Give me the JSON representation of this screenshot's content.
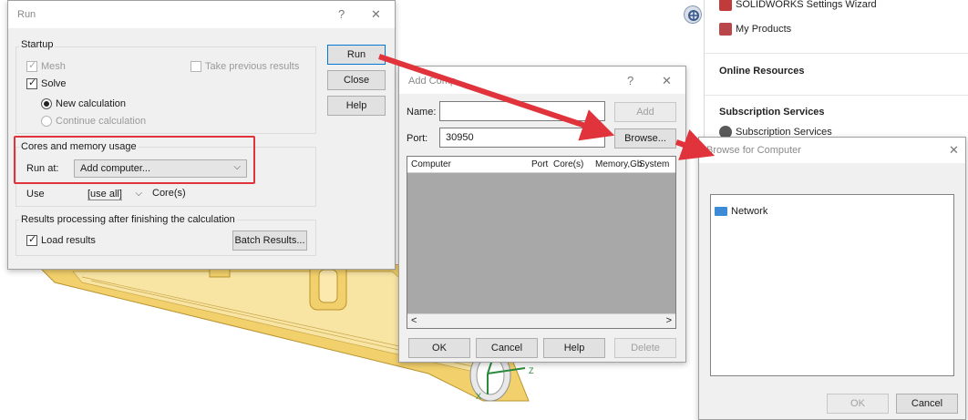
{
  "taskpane": {
    "wizard_label": "SOLIDWORKS Settings Wizard",
    "my_products": "My Products",
    "online_resources": "Online Resources",
    "subscription_services_head": "Subscription Services",
    "subscription_services_item": "Subscription Services"
  },
  "run_dialog": {
    "title": "Run",
    "help_glyph": "?",
    "close_glyph": "✕",
    "startup_group": "Startup",
    "mesh_label": "Mesh",
    "solve_label": "Solve",
    "take_previous_label": "Take previous results",
    "new_calc_label": "New calculation",
    "continue_calc_label": "Continue calculation",
    "cores_group": "Cores and memory usage",
    "run_at_label": "Run at:",
    "run_at_value": "Add computer...",
    "use_label": "Use",
    "use_value": "[use all]",
    "cores_suffix": "Core(s)",
    "results_group": "Results processing after finishing the calculation",
    "load_results_label": "Load results",
    "run_button": "Run",
    "close_button": "Close",
    "help_button": "Help",
    "batch_results_button": "Batch Results..."
  },
  "add_dialog": {
    "title": "Add Comp",
    "help_glyph": "?",
    "close_glyph": "✕",
    "name_label": "Name:",
    "name_value": "",
    "port_label": "Port:",
    "port_value": "30950",
    "add_button": "Add",
    "browse_button": "Browse...",
    "columns": [
      "Computer",
      "Port",
      "Core(s)",
      "Memory,Gb",
      "System"
    ],
    "scroll_left": "<",
    "scroll_right": ">",
    "ok_button": "OK",
    "cancel_button": "Cancel",
    "help_button": "Help",
    "delete_button": "Delete"
  },
  "browse_dialog": {
    "title": "Browse for Computer",
    "close_glyph": "✕",
    "tree_items": [
      "Network"
    ],
    "ok_button": "OK",
    "cancel_button": "Cancel"
  },
  "model": {
    "axis_z": "Z",
    "axis_x": "X"
  },
  "colors": {
    "arrow": "#e0333b",
    "part_fill": "#f2d06b",
    "part_edge": "#b99432"
  },
  "icons": [
    "wizard-icon",
    "products-icon",
    "subscription-icon",
    "network-icon",
    "solidworks-logo-icon"
  ]
}
